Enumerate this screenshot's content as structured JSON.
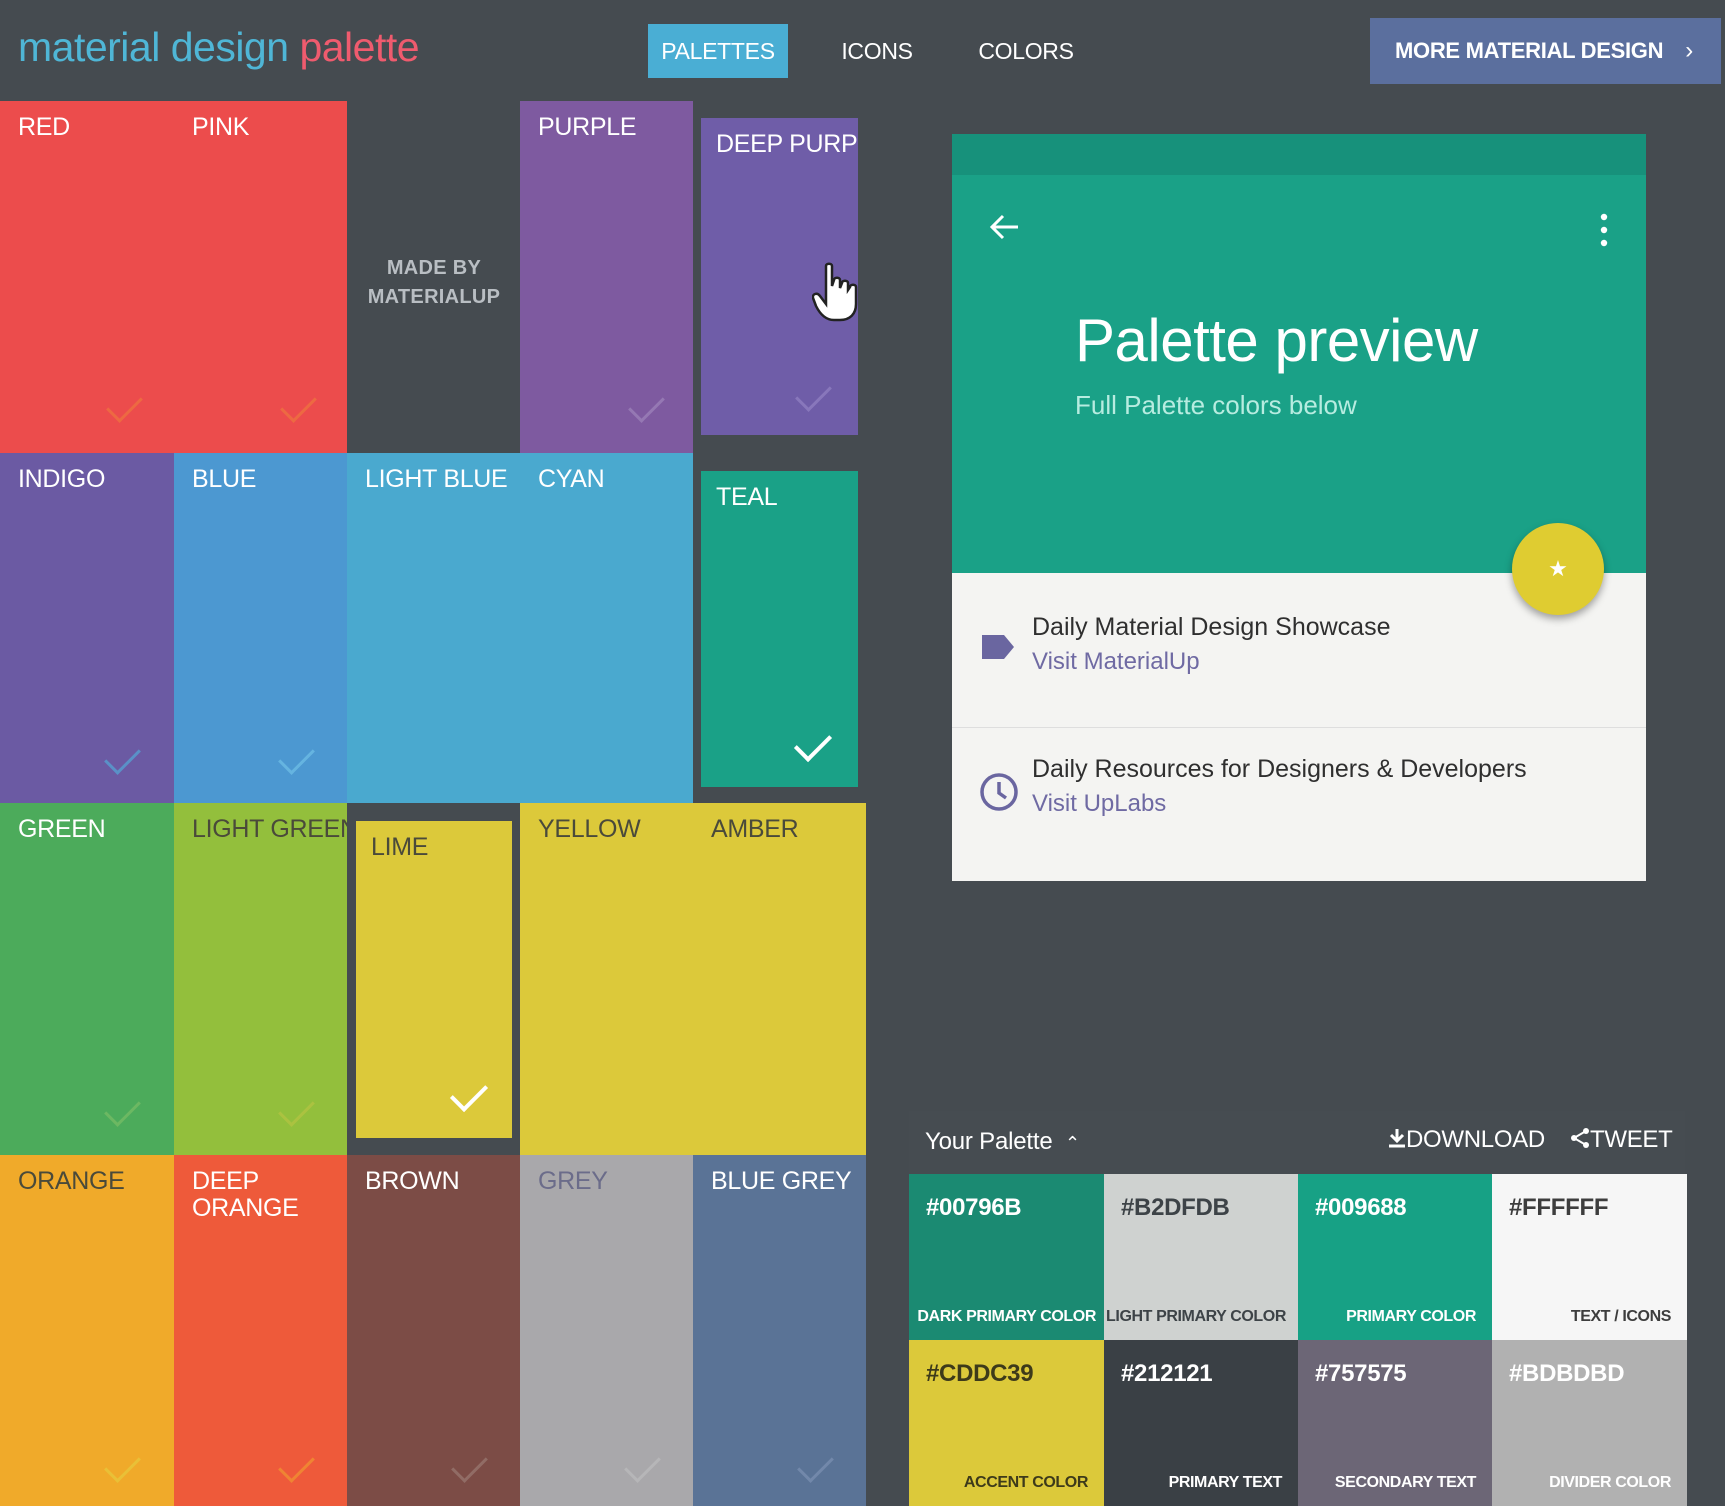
{
  "header": {
    "logo_part1": "material design",
    "logo_part2": "palette",
    "tabs": [
      {
        "label": "PALETTES",
        "active": true
      },
      {
        "label": "ICONS",
        "active": false
      },
      {
        "label": "COLORS",
        "active": false
      }
    ],
    "more_button": "MORE MATERIAL DESIGN",
    "more_chevron": "›"
  },
  "swatches": [
    {
      "label": "RED",
      "color": "#ec4c4c"
    },
    {
      "label": "PINK",
      "color": "#ec4c4c"
    },
    {
      "label": "PURPLE",
      "color": "#7e5aa0"
    },
    {
      "label": "DEEP PURPLE",
      "color": "#6f5da8"
    },
    {
      "label": "INDIGO",
      "color": "#6b5aa3"
    },
    {
      "label": "BLUE",
      "color": "#4c98d1"
    },
    {
      "label": "LIGHT BLUE",
      "color": "#4aa9cf"
    },
    {
      "label": "CYAN",
      "color": "#4aa9cf"
    },
    {
      "label": "TEAL",
      "color": "#1aa187"
    },
    {
      "label": "GREEN",
      "color": "#4cab5b"
    },
    {
      "label": "LIGHT GREEN",
      "color": "#93bf3c"
    },
    {
      "label": "LIME",
      "color": "#dcc93a"
    },
    {
      "label": "YELLOW",
      "color": "#dcc93a"
    },
    {
      "label": "AMBER",
      "color": "#dcc93a"
    },
    {
      "label": "ORANGE",
      "color": "#f0aa2a"
    },
    {
      "label": "DEEP ORANGE",
      "label_line1": "DEEP",
      "label_line2": "ORANGE",
      "color": "#ee5a3a"
    },
    {
      "label": "BROWN",
      "color": "#7c4c46"
    },
    {
      "label": "GREY",
      "color": "#a9a8ab"
    },
    {
      "label": "BLUE GREY",
      "color": "#5a7396"
    }
  ],
  "made_by": {
    "line1": "MADE BY",
    "line2": "MATERIALUP"
  },
  "preview": {
    "back_icon": "arrow-left-icon",
    "menu_icon": "more-vert-icon",
    "title": "Palette preview",
    "subtitle": "Full Palette colors below",
    "fab_icon": "★",
    "items": [
      {
        "icon": "label-tag-icon",
        "title": "Daily Material Design Showcase",
        "link": "Visit MaterialUp"
      },
      {
        "icon": "clock-icon",
        "title": "Daily Resources for Designers & Developers",
        "link": "Visit UpLabs"
      }
    ]
  },
  "your_palette": {
    "title": "Your Palette",
    "caret": "⌃",
    "download_label": "DOWNLOAD",
    "tweet_label": "TWEET",
    "colors": [
      {
        "hex": "#00796B",
        "role": "DARK PRIMARY COLOR",
        "bg": "#1b8a72",
        "fg": "#ffffff"
      },
      {
        "hex": "#B2DFDB",
        "role": "LIGHT PRIMARY COLOR",
        "bg": "#cfd2d0",
        "fg": "#3d4347"
      },
      {
        "hex": "#009688",
        "role": "PRIMARY COLOR",
        "bg": "#17a185",
        "fg": "#ffffff"
      },
      {
        "hex": "#FFFFFF",
        "role": "TEXT / ICONS",
        "bg": "#f6f6f6",
        "fg": "#3d3d3d"
      },
      {
        "hex": "#CDDC39",
        "role": "ACCENT COLOR",
        "bg": "#dcc93a",
        "fg": "#3d3a1a"
      },
      {
        "hex": "#212121",
        "role": "PRIMARY TEXT",
        "bg": "#3a4045",
        "fg": "#ffffff"
      },
      {
        "hex": "#757575",
        "role": "SECONDARY TEXT",
        "bg": "#6c6676",
        "fg": "#ffffff"
      },
      {
        "hex": "#BDBDBD",
        "role": "DIVIDER COLOR",
        "bg": "#b1b1b1",
        "fg": "#ffffff"
      }
    ]
  }
}
